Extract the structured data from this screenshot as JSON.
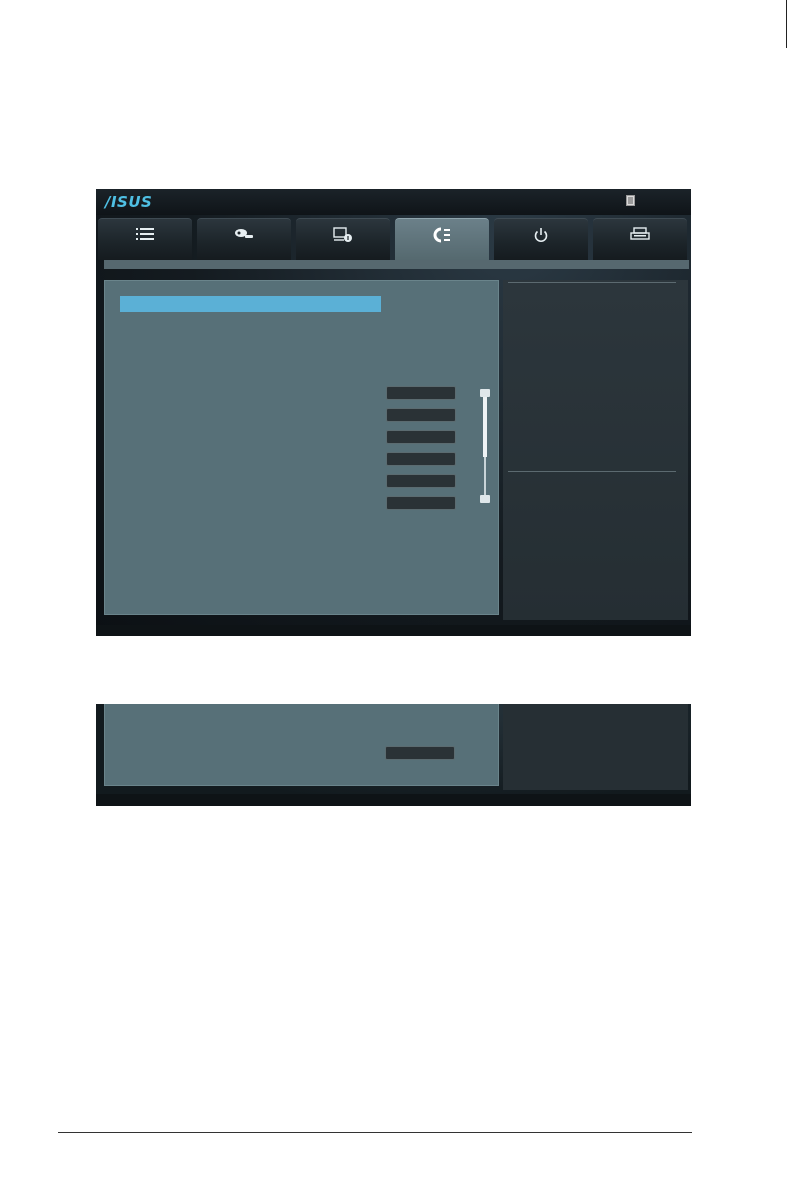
{
  "brand": {
    "logo_text": "/ISUS"
  },
  "tabs": [
    {
      "icon": "list-icon",
      "active": false
    },
    {
      "icon": "tweaker-icon",
      "active": false
    },
    {
      "icon": "system-info-icon",
      "active": false
    },
    {
      "icon": "monitor-icon",
      "active": true
    },
    {
      "icon": "power-icon",
      "active": false
    },
    {
      "icon": "tool-icon",
      "active": false
    }
  ],
  "colors": {
    "accent": "#5bb0d6",
    "panel": "#577078",
    "background": "#141b20",
    "button": "#2a3236"
  },
  "value_buttons_count": 6
}
